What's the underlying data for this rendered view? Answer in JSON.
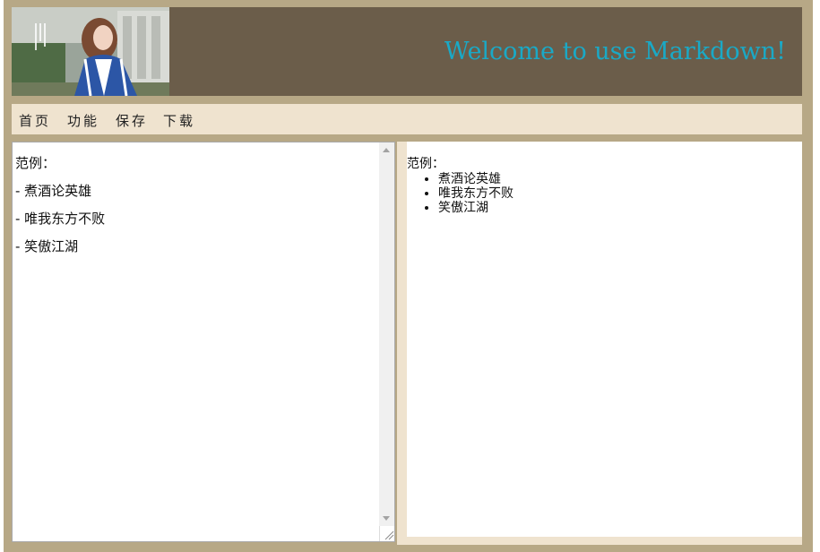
{
  "header": {
    "title": "Welcome to use Markdown!",
    "banner_alt": "photo-banner"
  },
  "nav": {
    "items": [
      {
        "label": "首页"
      },
      {
        "label": "功能"
      },
      {
        "label": "保存"
      },
      {
        "label": "下载"
      }
    ]
  },
  "editor": {
    "content": "范例：\n- 煮酒论英雄\n- 唯我东方不败\n- 笑傲江湖"
  },
  "preview": {
    "heading": "范例：",
    "items": [
      "煮酒论英雄",
      "唯我东方不败",
      "笑傲江湖"
    ]
  },
  "colors": {
    "frame": "#b7a886",
    "header": "#6b5d4a",
    "title": "#1aa9c6",
    "nav": "#efe3cf"
  }
}
